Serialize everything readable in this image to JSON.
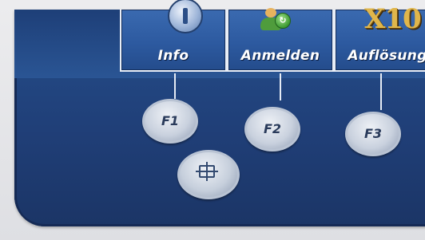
{
  "softkeys": [
    {
      "label": "Info",
      "icon": "info-icon"
    },
    {
      "label": "Anmelden",
      "icon": "login-user-icon"
    },
    {
      "label": "Auflösung",
      "icon": "x10-icon",
      "icon_text": "X10"
    }
  ],
  "function_keys": [
    {
      "label": "F1"
    },
    {
      "label": "F2"
    },
    {
      "label": "F3"
    }
  ],
  "nav_key": {
    "icon": "navigation-cross-icon"
  },
  "colors": {
    "panel": "#234a86",
    "softkey": "#2d5aa0",
    "button": "#c9d1de",
    "label": "#ffffff",
    "x10_gold": "#e0b64b"
  }
}
